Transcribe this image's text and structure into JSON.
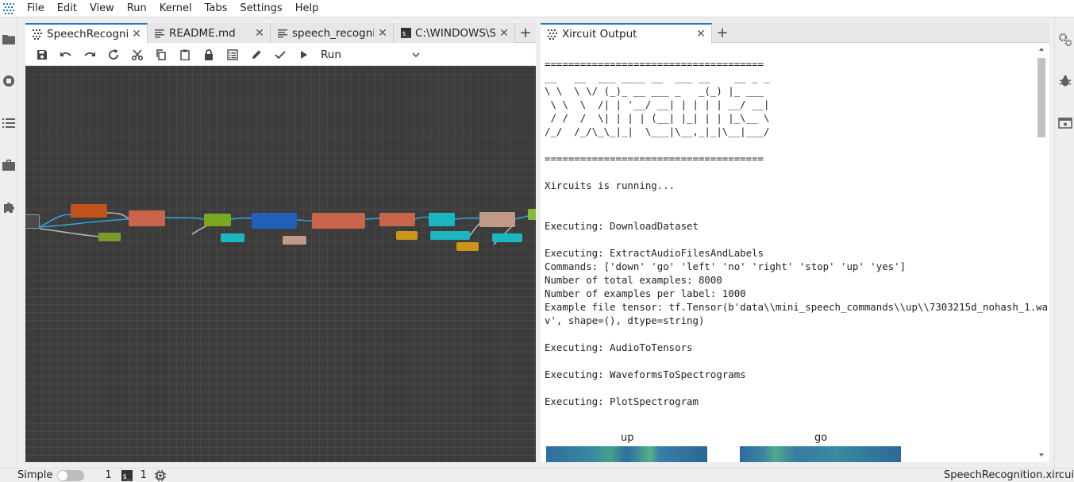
{
  "menubar": {
    "items": [
      "File",
      "Edit",
      "View",
      "Run",
      "Kernel",
      "Tabs",
      "Settings",
      "Help"
    ]
  },
  "left_sidebar": {
    "icons": [
      "folder-icon",
      "stop-circle-icon",
      "list-icon",
      "toolbox-icon",
      "puzzle-icon"
    ]
  },
  "right_sidebar": {
    "icons": [
      "gears-icon",
      "bug-icon",
      "property-inspector-icon"
    ]
  },
  "editor": {
    "tabs": [
      {
        "label": "SpeechRecognitio",
        "icon": "xircuits-icon",
        "active": true
      },
      {
        "label": "README.md",
        "icon": "markdown-icon",
        "active": false
      },
      {
        "label": "speech_recognitio",
        "icon": "text-file-icon",
        "active": false
      },
      {
        "label": "C:\\WINDOWS\\Sys",
        "icon": "terminal-icon",
        "active": false
      }
    ],
    "toolbar": {
      "buttons": [
        "save-icon",
        "undo-icon",
        "redo-icon",
        "reload-icon",
        "cut-icon",
        "copy-icon",
        "paste-icon",
        "lock-icon",
        "log-icon",
        "edit-icon",
        "check-icon",
        "play-icon"
      ],
      "run_select": "Run"
    }
  },
  "output": {
    "tab_label": "Xircuit Output",
    "text": "=====================================\n__   __  ___ ____ __  ___ __    __ _ _\n\\ \\  \\ \\/ (_)_ __ ___ _   _(_) |_ ___\n \\ \\  \\  /| | '__/ __| | | | | __/ __|\n / /  /  \\| | | | (__| |_| | | |_\\__ \\\n/_/  /_/\\_\\_|_|  \\___|\\__,_|_|\\__|___/\n\n=====================================\n\nXircuits is running...\n\n\nExecuting: DownloadDataset\n\nExecuting: ExtractAudioFilesAndLabels\nCommands: ['down' 'go' 'left' 'no' 'right' 'stop' 'up' 'yes']\nNumber of total examples: 8000\nNumber of examples per label: 1000\nExample file tensor: tf.Tensor(b'data\\\\mini_speech_commands\\\\up\\\\7303215d_nohash_1.wa\nv', shape=(), dtype=string)\n\nExecuting: AudioToTensors\n\nExecuting: WaveformsToSpectrograms\n\nExecuting: PlotSpectrogram",
    "spectrograms": [
      {
        "label": "up"
      },
      {
        "label": "go"
      }
    ]
  },
  "statusbar": {
    "mode_label": "Simple",
    "count_a": "1",
    "count_b": "1",
    "file_name": "SpeechRecognition.xircuits"
  },
  "colors": {
    "accent": "#1f77d0",
    "canvas_bg": "#3c3c3c",
    "link": "#2aa6e0"
  }
}
